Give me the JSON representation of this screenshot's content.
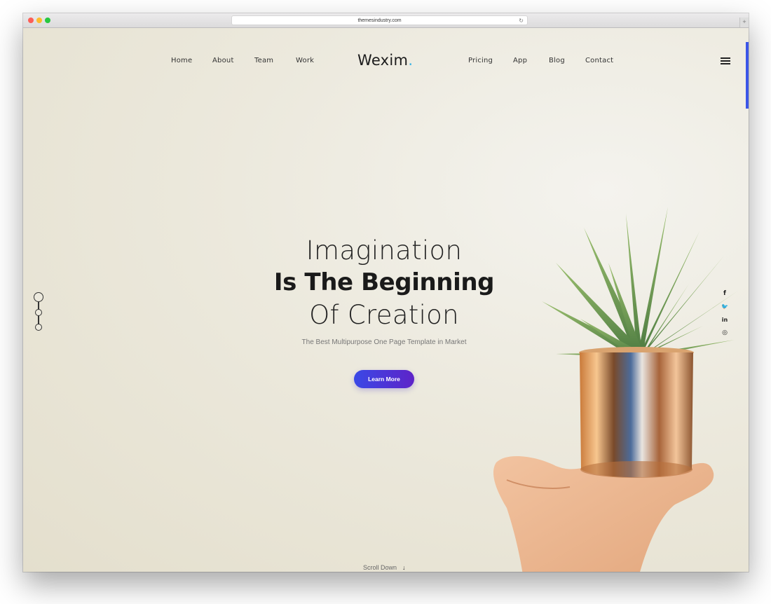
{
  "browser": {
    "url": "themesindustry.com",
    "new_tab_symbol": "+",
    "reload_symbol": "↻"
  },
  "nav": {
    "left_links": [
      "Home",
      "About",
      "Team",
      "Work"
    ],
    "right_links": [
      "Pricing",
      "App",
      "Blog",
      "Contact"
    ],
    "logo_text": "Wexim",
    "logo_dot": "."
  },
  "hero": {
    "line1": "Imagination",
    "line2": "Is The Beginning",
    "line3": "Of Creation",
    "subtitle": "The Best Multipurpose One Page Template in Market",
    "button_label": "Learn More",
    "scroll_label": "Scroll Down",
    "scroll_arrow": "↓"
  },
  "social": {
    "facebook": "f",
    "twitter": "🐦",
    "linkedin": "in",
    "instagram": "◎"
  },
  "colors": {
    "accent_blue": "#3b56e8",
    "button_gradient_start": "#3a49e6",
    "button_gradient_end": "#5e23c8",
    "logo_dot": "#3ab4e6"
  },
  "icons": [
    "hamburger-menu-icon",
    "facebook-icon",
    "twitter-icon",
    "linkedin-icon",
    "instagram-icon",
    "reload-icon",
    "arrow-down-icon"
  ]
}
